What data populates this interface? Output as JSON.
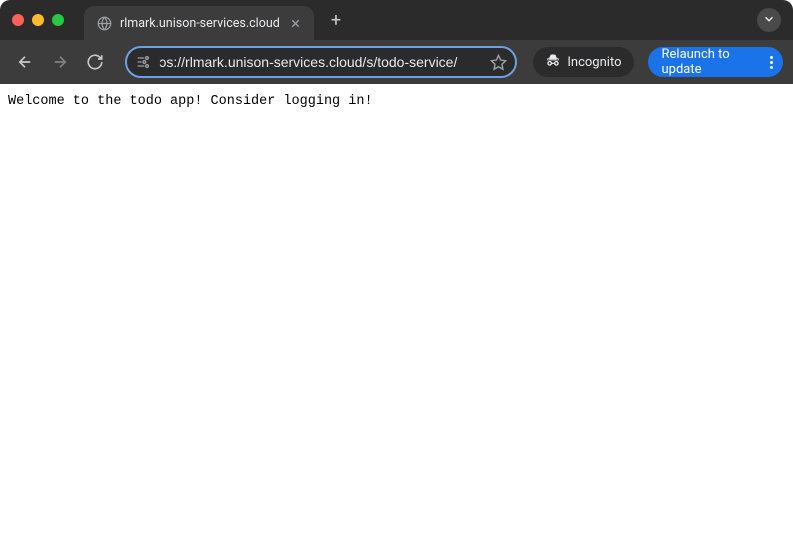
{
  "window": {
    "traffic_lights": [
      "close",
      "minimize",
      "zoom"
    ]
  },
  "tab": {
    "title": "rlmark.unison-services.cloud",
    "favicon": "globe-icon"
  },
  "toolbar": {
    "back": "Back",
    "forward": "Forward",
    "reload": "Reload",
    "new_tab": "+",
    "url": "ɔs://rlmark.unison-services.cloud/s/todo-service/",
    "incognito_label": "Incognito",
    "relaunch_label": "Relaunch to update"
  },
  "page": {
    "body_text": "Welcome to the todo app! Consider logging in!"
  }
}
